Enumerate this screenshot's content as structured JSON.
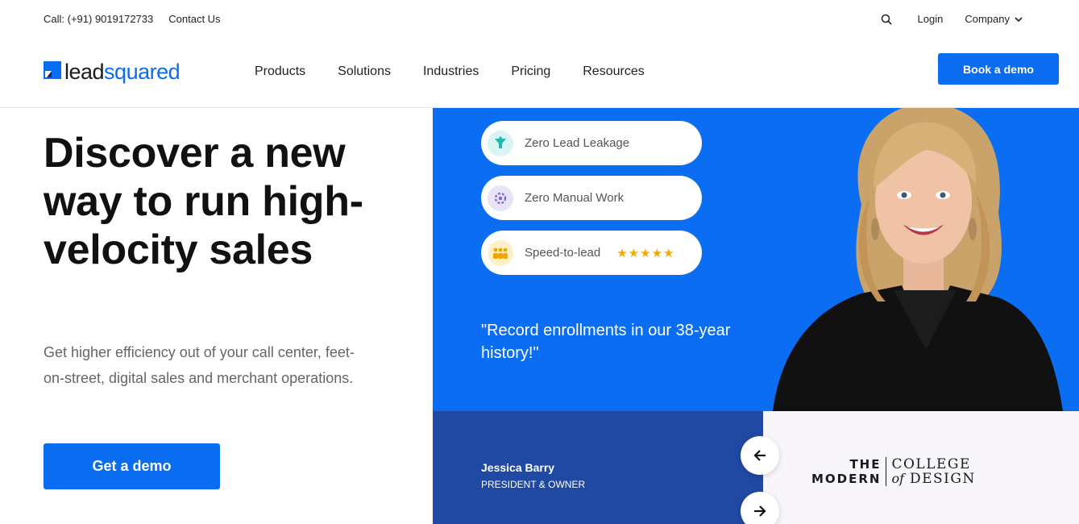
{
  "topbar": {
    "call": "Call: (+91) 9019172733",
    "contact": "Contact Us",
    "login": "Login",
    "company": "Company"
  },
  "nav": {
    "logo_left": "lead",
    "logo_right": "squared",
    "items": [
      "Products",
      "Solutions",
      "Industries",
      "Pricing",
      "Resources"
    ],
    "book_demo": "Book a demo"
  },
  "hero": {
    "title": "Discover a new way to run high-velocity sales",
    "subtitle": "Get higher efficiency out of your call center, feet-on-street, digital sales and merchant operations.",
    "cta": "Get a demo"
  },
  "testimonial": {
    "pills": [
      {
        "label": "Zero Lead Leakage",
        "icon": "funnel-icon",
        "color": "#d9f4f3"
      },
      {
        "label": "Zero Manual Work",
        "icon": "gear-icon",
        "color": "#e8e4f6"
      },
      {
        "label": "Speed-to-lead",
        "icon": "team-icon",
        "color": "#fdf0c6",
        "stars": "★★★★★"
      }
    ],
    "quote": "\"Record enrollments in our 38-year history!\"",
    "name": "Jessica Barry",
    "role": "PRESIDENT & OWNER",
    "brand_the": "THE",
    "brand_modern": "MODERN",
    "brand_college": "COLLEGE",
    "brand_of": "of",
    "brand_design": "DESIGN"
  },
  "colors": {
    "accent": "#0a6cf1",
    "panel_blue": "#0b6ef2",
    "panel_dark": "#2049a3",
    "star": "#f5a800"
  }
}
